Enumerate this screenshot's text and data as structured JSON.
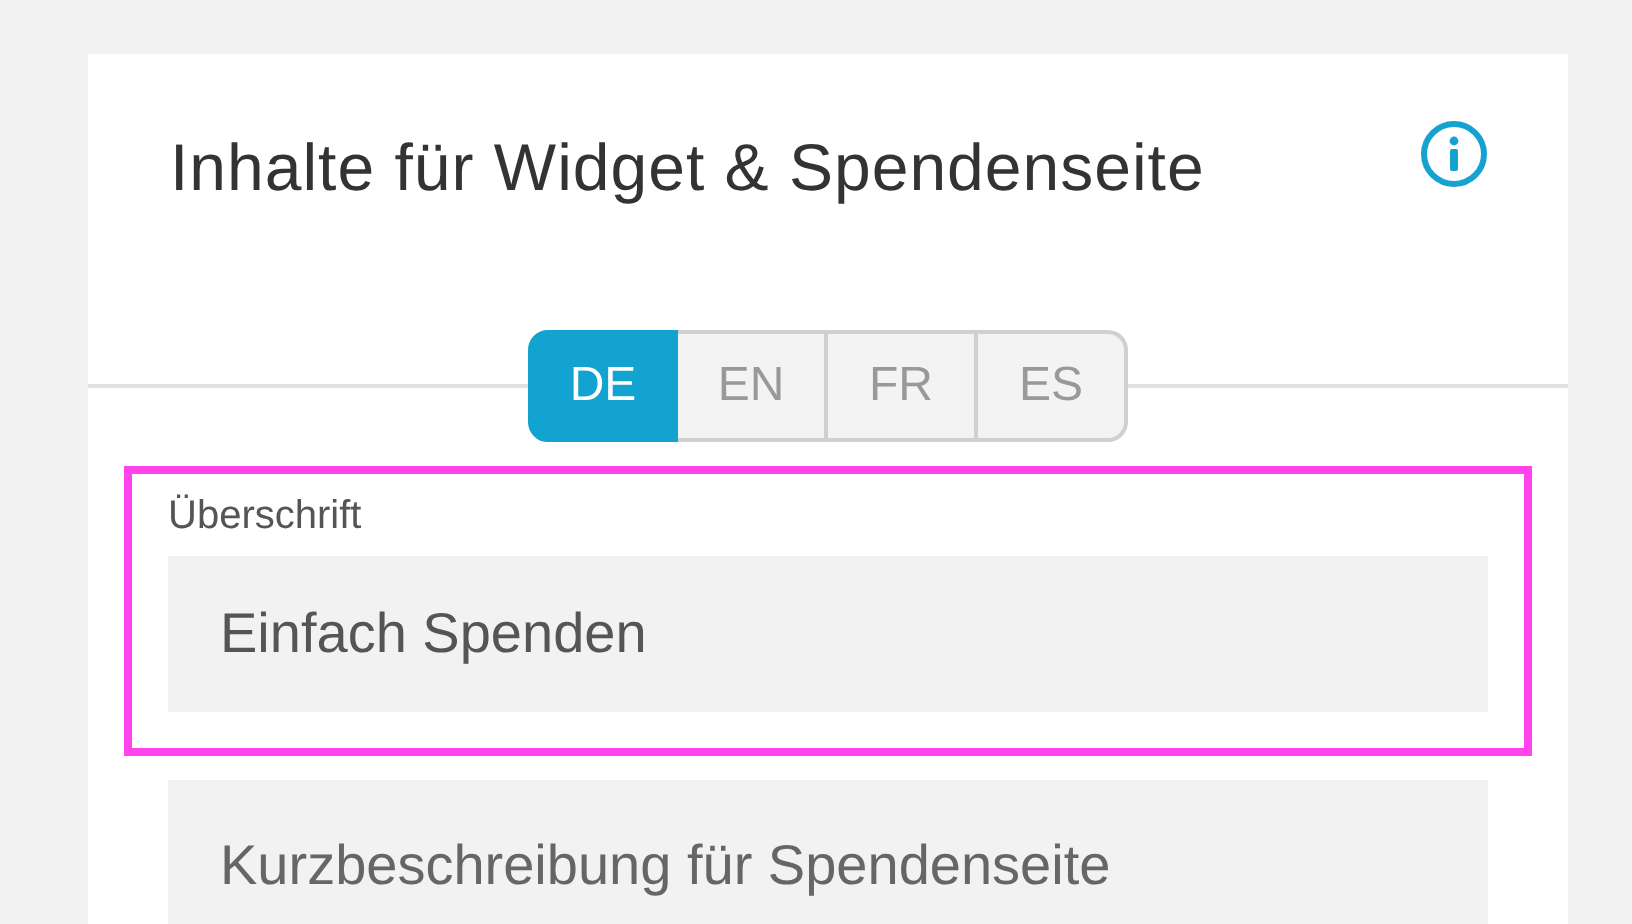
{
  "card": {
    "title": "Inhalte für Widget & Spendenseite"
  },
  "language_tabs": [
    {
      "label": "DE",
      "selected": true
    },
    {
      "label": "EN",
      "selected": false
    },
    {
      "label": "FR",
      "selected": false
    },
    {
      "label": "ES",
      "selected": false
    }
  ],
  "fields": [
    {
      "label": "Überschrift",
      "value": "Einfach Spenden",
      "highlighted": true
    },
    {
      "placeholder": "Kurzbeschreibung für Spendenseite",
      "highlighted": false
    }
  ]
}
